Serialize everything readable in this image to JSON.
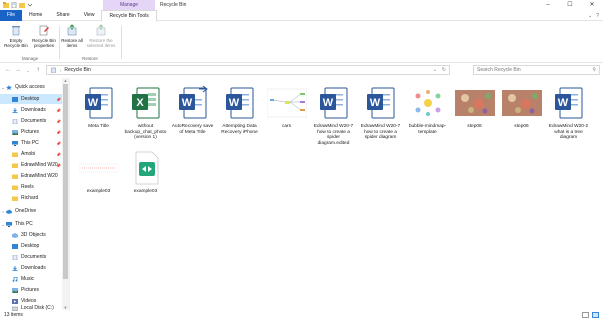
{
  "titlebar": {
    "context_tab": "Manage",
    "window_title": "Recycle Bin",
    "controls": [
      "–",
      "☐",
      "✕"
    ]
  },
  "tabs": [
    {
      "label": "File"
    },
    {
      "label": "Home"
    },
    {
      "label": "Share"
    },
    {
      "label": "View"
    },
    {
      "label": "Recycle Bin Tools"
    }
  ],
  "ribbon": {
    "empty_label": "Empty Recycle Bin",
    "props_label": "Recycle Bin properties",
    "manage_group": "Manage",
    "restore_all_label": "Restore all items",
    "restore_sel_label": "Restore the selected items",
    "restore_group": "Restore"
  },
  "address": {
    "path": "Recycle Bin",
    "search_placeholder": "Search Recycle Bin"
  },
  "sidebar": {
    "quick_access": "Quick access",
    "items": [
      {
        "label": "Desktop",
        "icon": "folder-blue-icon",
        "pinned": true
      },
      {
        "label": "Downloads",
        "icon": "download-icon",
        "pinned": true
      },
      {
        "label": "Documents",
        "icon": "documents-icon",
        "pinned": true
      },
      {
        "label": "Pictures",
        "icon": "pictures-icon",
        "pinned": true
      },
      {
        "label": "This PC",
        "icon": "pc-icon",
        "pinned": true
      },
      {
        "label": "Amobi",
        "icon": "folder-icon",
        "pinned": true
      },
      {
        "label": "EdrawMind W20",
        "icon": "folder-icon",
        "pinned": true
      },
      {
        "label": "EdrawMind W20",
        "icon": "folder-icon",
        "pinned": false
      },
      {
        "label": "Reels",
        "icon": "folder-icon",
        "pinned": false
      },
      {
        "label": "Richard",
        "icon": "folder-icon",
        "pinned": false
      }
    ],
    "onedrive": "OneDrive",
    "this_pc": "This PC",
    "pc_items": [
      {
        "label": "3D Objects",
        "icon": "3d-icon"
      },
      {
        "label": "Desktop",
        "icon": "folder-blue-icon"
      },
      {
        "label": "Documents",
        "icon": "documents-icon"
      },
      {
        "label": "Downloads",
        "icon": "download-icon"
      },
      {
        "label": "Music",
        "icon": "music-icon"
      },
      {
        "label": "Pictures",
        "icon": "pictures-icon"
      },
      {
        "label": "Videos",
        "icon": "videos-icon"
      },
      {
        "label": "Local Disk (C:)",
        "icon": "disk-icon"
      }
    ]
  },
  "files": [
    {
      "name": "Meta Title",
      "type": "word"
    },
    {
      "name": "without backup_chat_photo (version 1)",
      "type": "excel"
    },
    {
      "name": "AutoRecovery save of Meta Title",
      "type": "word-recover"
    },
    {
      "name": "Attempting Data Recovery iPhone",
      "type": "word"
    },
    {
      "name": "cars",
      "type": "mindmap-small"
    },
    {
      "name": "EdrawMind W20-7 how to create a spider diagram.edited",
      "type": "word"
    },
    {
      "name": "EdrawMind W20-7 how to create a spider diagram",
      "type": "word"
    },
    {
      "name": "bubble-mindmap-template",
      "type": "bubble"
    },
    {
      "name": "step06",
      "type": "photo"
    },
    {
      "name": "step06",
      "type": "photo"
    },
    {
      "name": "EdrawMind W20-2 what is a tree diagram",
      "type": "word"
    },
    {
      "name": "example03",
      "type": "screenshot"
    },
    {
      "name": "example03",
      "type": "edrawmind"
    }
  ],
  "status": {
    "count": "13 items"
  }
}
